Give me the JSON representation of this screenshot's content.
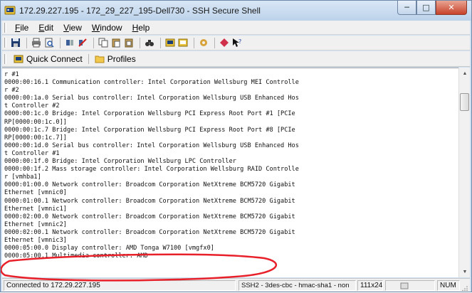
{
  "window": {
    "title": "172.29.227.195 - 172_29_227_195-Dell730 - SSH Secure Shell",
    "controls": {
      "minimize": "─",
      "maximize": "□",
      "close": "✕"
    }
  },
  "menu": {
    "items": [
      {
        "key": "F",
        "rest": "ile"
      },
      {
        "key": "E",
        "rest": "dit"
      },
      {
        "key": "V",
        "rest": "iew"
      },
      {
        "key": "W",
        "rest": "indow"
      },
      {
        "key": "H",
        "rest": "elp"
      }
    ]
  },
  "toolbar": {
    "icons": [
      "save-icon",
      "print-icon",
      "print-preview-icon",
      "connect-icon",
      "disconnect-icon",
      "copy-icon",
      "paste-icon",
      "paste-special-icon",
      "find-icon",
      "new-terminal-icon",
      "new-file-transfer-icon",
      "settings-icon",
      "profile-icon",
      "help-icon"
    ]
  },
  "quickbar": {
    "quick_connect": "Quick Connect",
    "profiles": "Profiles"
  },
  "terminal": {
    "lines": [
      "r #1",
      "0000:00:16.1 Communication controller: Intel Corporation Wellsburg MEI Controlle",
      "r #2",
      "0000:00:1a.0 Serial bus controller: Intel Corporation Wellsburg USB Enhanced Hos",
      "t Controller #2",
      "0000:00:1c.0 Bridge: Intel Corporation Wellsburg PCI Express Root Port #1 [PCIe",
      "RP[0000:00:1c.0]]",
      "0000:00:1c.7 Bridge: Intel Corporation Wellsburg PCI Express Root Port #8 [PCIe",
      "RP[0000:00:1c.7]]",
      "0000:00:1d.0 Serial bus controller: Intel Corporation Wellsburg USB Enhanced Hos",
      "t Controller #1",
      "0000:00:1f.0 Bridge: Intel Corporation Wellsburg LPC Controller",
      "0000:00:1f.2 Mass storage controller: Intel Corporation Wellsburg RAID Controlle",
      "r [vmhba1]",
      "0000:01:00.0 Network controller: Broadcom Corporation NetXtreme BCM5720 Gigabit",
      "Ethernet [vmnic0]",
      "0000:01:00.1 Network controller: Broadcom Corporation NetXtreme BCM5720 Gigabit",
      "Ethernet [vmnic1]",
      "0000:02:00.0 Network controller: Broadcom Corporation NetXtreme BCM5720 Gigabit",
      "Ethernet [vmnic2]",
      "0000:02:00.1 Network controller: Broadcom Corporation NetXtreme BCM5720 Gigabit",
      "Ethernet [vmnic3]",
      "0000:05:00.0 Display controller: AMD Tonga W7100 [vmgfx0]",
      "0000:05:00.1 Multimedia controller: AMD"
    ]
  },
  "status": {
    "connection": "Connected to 172.29.227.195",
    "protocol": "SSH2 - 3des-cbc - hmac-sha1 - non",
    "size": "111x24",
    "num": "NUM"
  },
  "colors": {
    "annotation": "#e8202a",
    "title_bg": "#cfe0f3",
    "close_button": "#c7412a"
  }
}
